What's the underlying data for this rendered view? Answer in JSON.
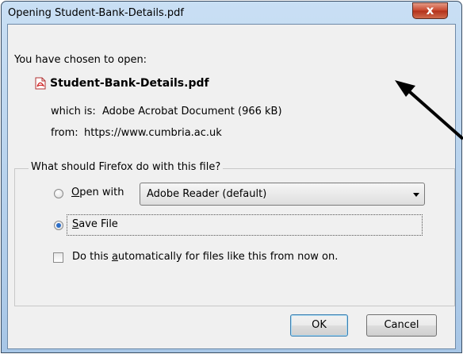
{
  "dialog": {
    "title": "Opening Student-Bank-Details.pdf",
    "close_glyph": "x"
  },
  "file": {
    "chosen_label": "You have chosen to open:",
    "icon": "pdf-file-icon",
    "name": "Student-Bank-Details.pdf",
    "which_label": "which is:",
    "which_value": "Adobe Acrobat Document (966 kB)",
    "from_label": "from:",
    "from_value": "https://www.cumbria.ac.uk"
  },
  "action_group": {
    "legend": "What should Firefox do with this file?",
    "open_with": {
      "label_mnemonic": "O",
      "label_rest": "pen with",
      "selected": false,
      "app": "Adobe Reader  (default)"
    },
    "save_file": {
      "label_mnemonic": "S",
      "label_rest": "ave File",
      "selected": true
    },
    "auto": {
      "label_pre": "Do this ",
      "label_mnemonic": "a",
      "label_rest": "utomatically for files like this from now on.",
      "checked": false
    }
  },
  "buttons": {
    "ok": "OK",
    "cancel": "Cancel"
  },
  "colors": {
    "titlebar": "#b9d3ee",
    "close": "#c7462c",
    "arrow": "#000000",
    "radio_dot": "#2c6ec8"
  }
}
